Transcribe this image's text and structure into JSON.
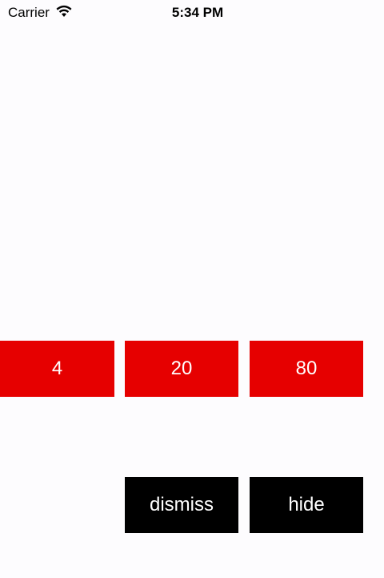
{
  "status_bar": {
    "carrier": "Carrier",
    "time": "5:34 PM",
    "wifi_icon": "wifi-icon"
  },
  "colors": {
    "background": "#fdfcfe",
    "value_button": "#e60000",
    "action_button": "#000000",
    "button_text": "#ffffff"
  },
  "value_buttons": [
    {
      "label": "4"
    },
    {
      "label": "20"
    },
    {
      "label": "80"
    }
  ],
  "action_buttons": {
    "dismiss_label": "dismiss",
    "hide_label": "hide"
  }
}
